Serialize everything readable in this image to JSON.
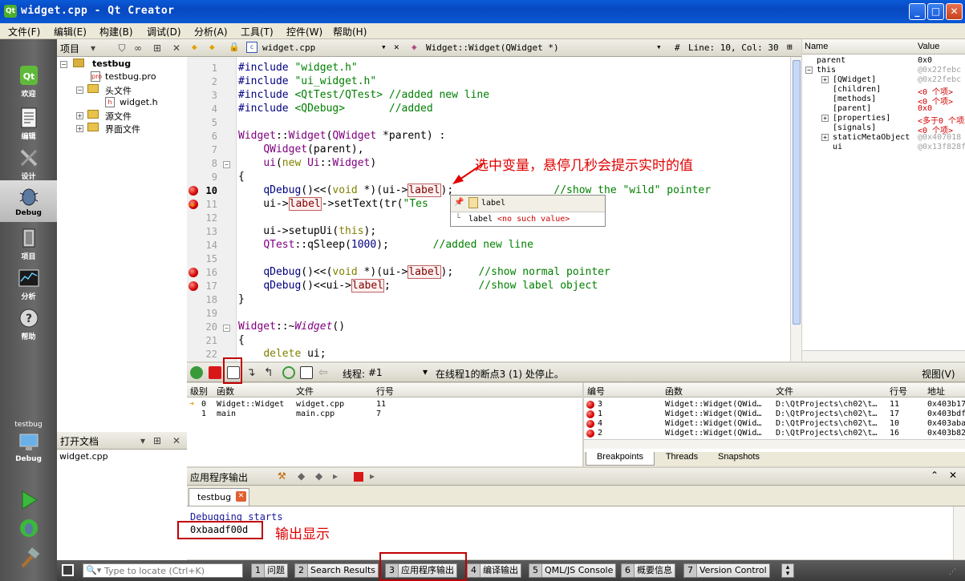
{
  "window": {
    "title": "widget.cpp - Qt Creator",
    "minimize": "_",
    "maximize": "□",
    "close": "✕"
  },
  "menu": [
    "文件(F)",
    "编辑(E)",
    "构建(B)",
    "调试(D)",
    "分析(A)",
    "工具(T)",
    "控件(W)",
    "帮助(H)"
  ],
  "modes": [
    {
      "label": "欢迎",
      "icon": "qt-welcome-icon"
    },
    {
      "label": "编辑",
      "icon": "edit-doc-icon"
    },
    {
      "label": "设计",
      "icon": "design-pen-icon"
    },
    {
      "label": "Debug",
      "icon": "debug-bug-icon"
    },
    {
      "label": "项目",
      "icon": "project-wrench-icon"
    },
    {
      "label": "分析",
      "icon": "analyze-graph-icon"
    },
    {
      "label": "帮助",
      "icon": "help-question-icon"
    }
  ],
  "kit": {
    "project": "testbug",
    "mode": "Debug"
  },
  "project_panel": {
    "title": "项目",
    "tree": [
      {
        "label": "testbug",
        "level": 0,
        "expander": "−",
        "kind": "project"
      },
      {
        "label": "testbug.pro",
        "level": 1,
        "kind": "pro"
      },
      {
        "label": "头文件",
        "level": 1,
        "expander": "−",
        "kind": "folder"
      },
      {
        "label": "widget.h",
        "level": 2,
        "kind": "header"
      },
      {
        "label": "源文件",
        "level": 1,
        "expander": "+",
        "kind": "folder"
      },
      {
        "label": "界面文件",
        "level": 1,
        "expander": "+",
        "kind": "folder"
      }
    ]
  },
  "open_docs": {
    "title": "打开文档",
    "files": [
      "widget.cpp"
    ]
  },
  "editor": {
    "file": "widget.cpp",
    "symbol": "Widget::Widget(QWidget *)",
    "hash": "#",
    "position": "Line: 10, Col: 30"
  },
  "code_lines": [
    1,
    2,
    3,
    4,
    5,
    6,
    7,
    8,
    9,
    10,
    11,
    12,
    13,
    14,
    15,
    16,
    17,
    18,
    19,
    20,
    21,
    22
  ],
  "tooltip": {
    "title": "label",
    "row": "label",
    "value": "<no such value>"
  },
  "locals": {
    "col_name": "Name",
    "col_value": "Value",
    "rows": [
      {
        "name": "parent",
        "value": "0x0",
        "level": 0,
        "color": "#000000"
      },
      {
        "name": "this",
        "value": "@0x22febc",
        "level": 0,
        "expander": "−",
        "color": "#a0a0a0"
      },
      {
        "name": "[QWidget]",
        "value": "@0x22febc",
        "level": 1,
        "expander": "+",
        "color": "#a0a0a0"
      },
      {
        "name": "[children]",
        "value": "<0 个项>",
        "level": 1,
        "color": "#d00000"
      },
      {
        "name": "[methods]",
        "value": "<0 个项>",
        "level": 1,
        "color": "#d00000"
      },
      {
        "name": "[parent]",
        "value": "0x0",
        "level": 1,
        "color": "#d00000"
      },
      {
        "name": "[properties]",
        "value": "<多于0 个项>",
        "level": 1,
        "expander": "+",
        "color": "#d00000"
      },
      {
        "name": "[signals]",
        "value": "<0 个项>",
        "level": 1,
        "color": "#d00000"
      },
      {
        "name": "staticMetaObject",
        "value": "@0x407018",
        "level": 1,
        "expander": "+",
        "color": "#a0a0a0"
      },
      {
        "name": "ui",
        "value": "@0x13f828f",
        "level": 1,
        "color": "#a0a0a0"
      }
    ]
  },
  "debug_toolbar": {
    "thread_label": "线程:",
    "thread_value": "#1",
    "status": "在线程1的断点3 (1) 处停止。",
    "view": "视图(V)"
  },
  "stack": {
    "headers": [
      "级别",
      "函数",
      "文件",
      "行号"
    ],
    "rows": [
      {
        "level": "0",
        "func": "Widget::Widget",
        "file": "widget.cpp",
        "line": "11",
        "current": true
      },
      {
        "level": "1",
        "func": "main",
        "file": "main.cpp",
        "line": "7",
        "current": false
      }
    ]
  },
  "breakpoints": {
    "headers": [
      "编号",
      "函数",
      "文件",
      "行号",
      "地址"
    ],
    "rows": [
      {
        "num": "3",
        "func": "Widget::Widget(QWid…",
        "file": "D:\\QtProjects\\ch02\\t…",
        "line": "11",
        "addr": "0x403b17"
      },
      {
        "num": "1",
        "func": "Widget::Widget(QWid…",
        "file": "D:\\QtProjects\\ch02\\t…",
        "line": "17",
        "addr": "0x403bdf"
      },
      {
        "num": "4",
        "func": "Widget::Widget(QWid…",
        "file": "D:\\QtProjects\\ch02\\t…",
        "line": "10",
        "addr": "0x403aba"
      },
      {
        "num": "2",
        "func": "Widget::Widget(QWid…",
        "file": "D:\\QtProjects\\ch02\\t…",
        "line": "16",
        "addr": "0x403b82"
      }
    ],
    "tabs": [
      "Breakpoints",
      "Threads",
      "Snapshots"
    ]
  },
  "output": {
    "title": "应用程序输出",
    "tab": "testbug",
    "lines": [
      "Debugging starts",
      "0xbaadf00d"
    ]
  },
  "statusbar": {
    "locate_placeholder": "Type to locate (Ctrl+K)",
    "tabs": [
      {
        "num": "1",
        "label": "问题"
      },
      {
        "num": "2",
        "label": "Search Results"
      },
      {
        "num": "3",
        "label": "应用程序输出"
      },
      {
        "num": "4",
        "label": "编译输出"
      },
      {
        "num": "5",
        "label": "QML/JS Console"
      },
      {
        "num": "6",
        "label": "概要信息"
      },
      {
        "num": "7",
        "label": "Version Control"
      }
    ]
  },
  "annotations": {
    "hover_hint": "选中变量，悬停几秒会提示实时的值",
    "output_hint": "输出显示"
  },
  "colors": {
    "titlebar": "#0a58d4",
    "annotation": "#e00000",
    "breakpoint": "#d00000"
  }
}
